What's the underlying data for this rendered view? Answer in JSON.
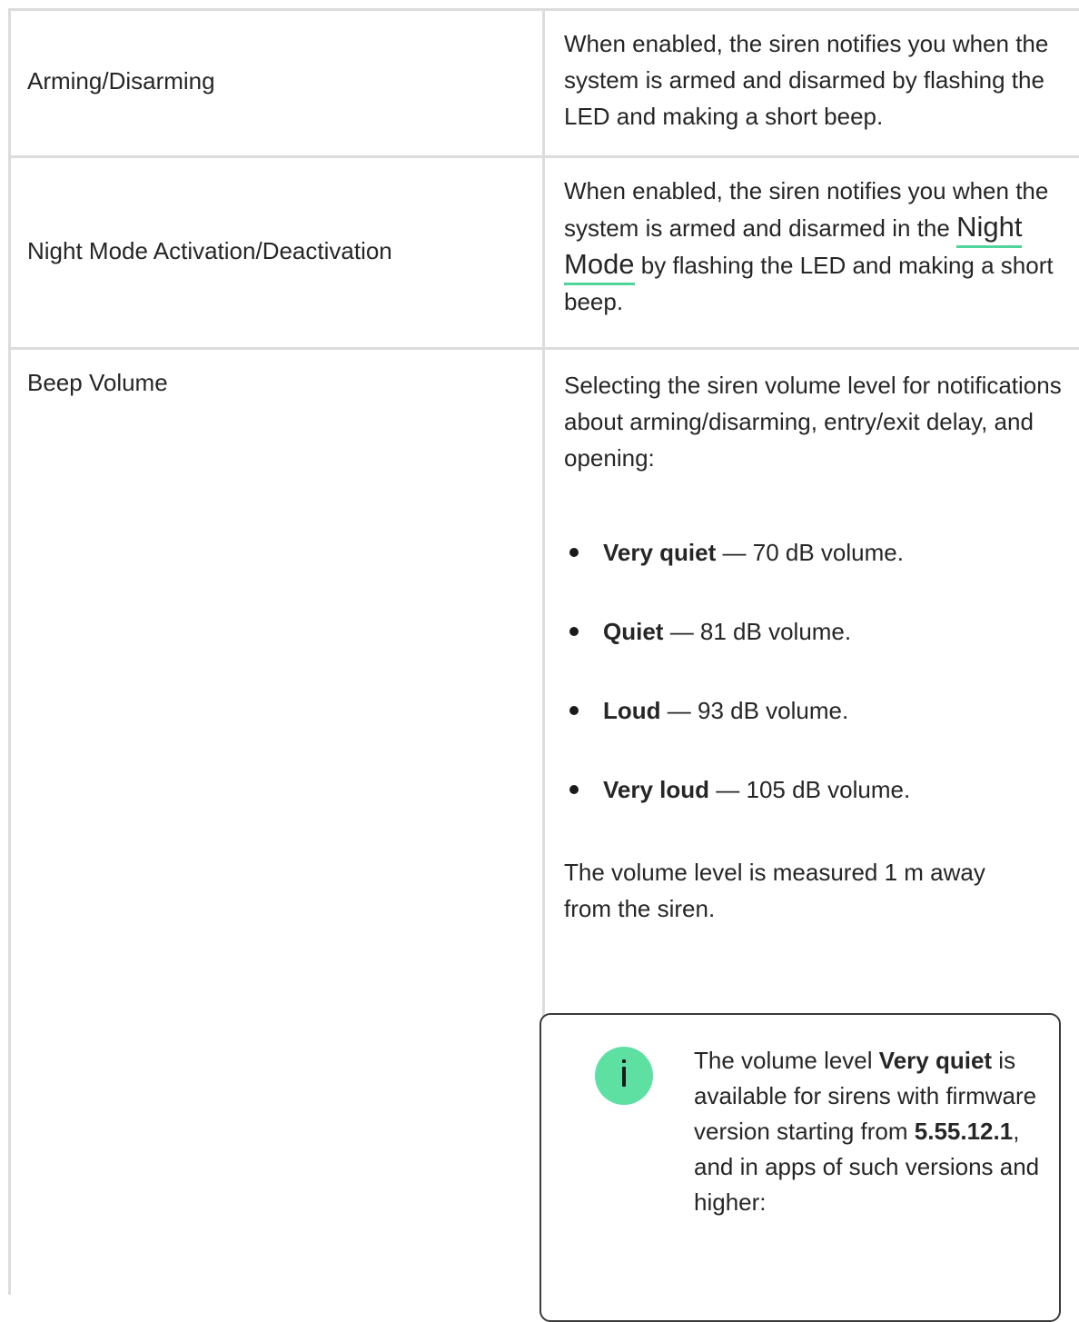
{
  "rows": [
    {
      "setting": "Arming/Disarming",
      "description": "When enabled, the siren notifies you when the system is armed and disarmed by flashing the LED and making a short beep."
    },
    {
      "setting": "Night Mode Activation/Deactivation",
      "description_before": "When enabled, the siren notifies you when the system is armed and disarmed in the",
      "link_text": "Night Mode",
      "description_after": "by flashing the LED and making a short beep."
    },
    {
      "setting": "Beep Volume",
      "intro": "Selecting the siren volume level for notifications about arming/disarming, entry/exit delay, and opening:",
      "levels": [
        {
          "name": "Very quiet",
          "detail": "— 70 dB volume."
        },
        {
          "name": "Quiet",
          "detail": "— 81 dB volume."
        },
        {
          "name": "Loud",
          "detail": "— 93 dB volume."
        },
        {
          "name": "Very loud",
          "detail": "— 105 dB volume."
        }
      ],
      "measure_note": "The volume level is measured 1 m away from the siren.",
      "info": {
        "icon": "info-icon",
        "icon_color": "#5fe0a3",
        "text_prefix": "The volume level",
        "bold_level": "Very quiet",
        "text_middle": "is available for sirens with firmware version starting from",
        "bold_version": "5.55.12.1",
        "text_suffix": ", and in apps of such versions and higher:"
      }
    }
  ],
  "colors": {
    "grid": "#dcdcdc",
    "link_underline": "#4fd49a",
    "text": "#262626"
  }
}
